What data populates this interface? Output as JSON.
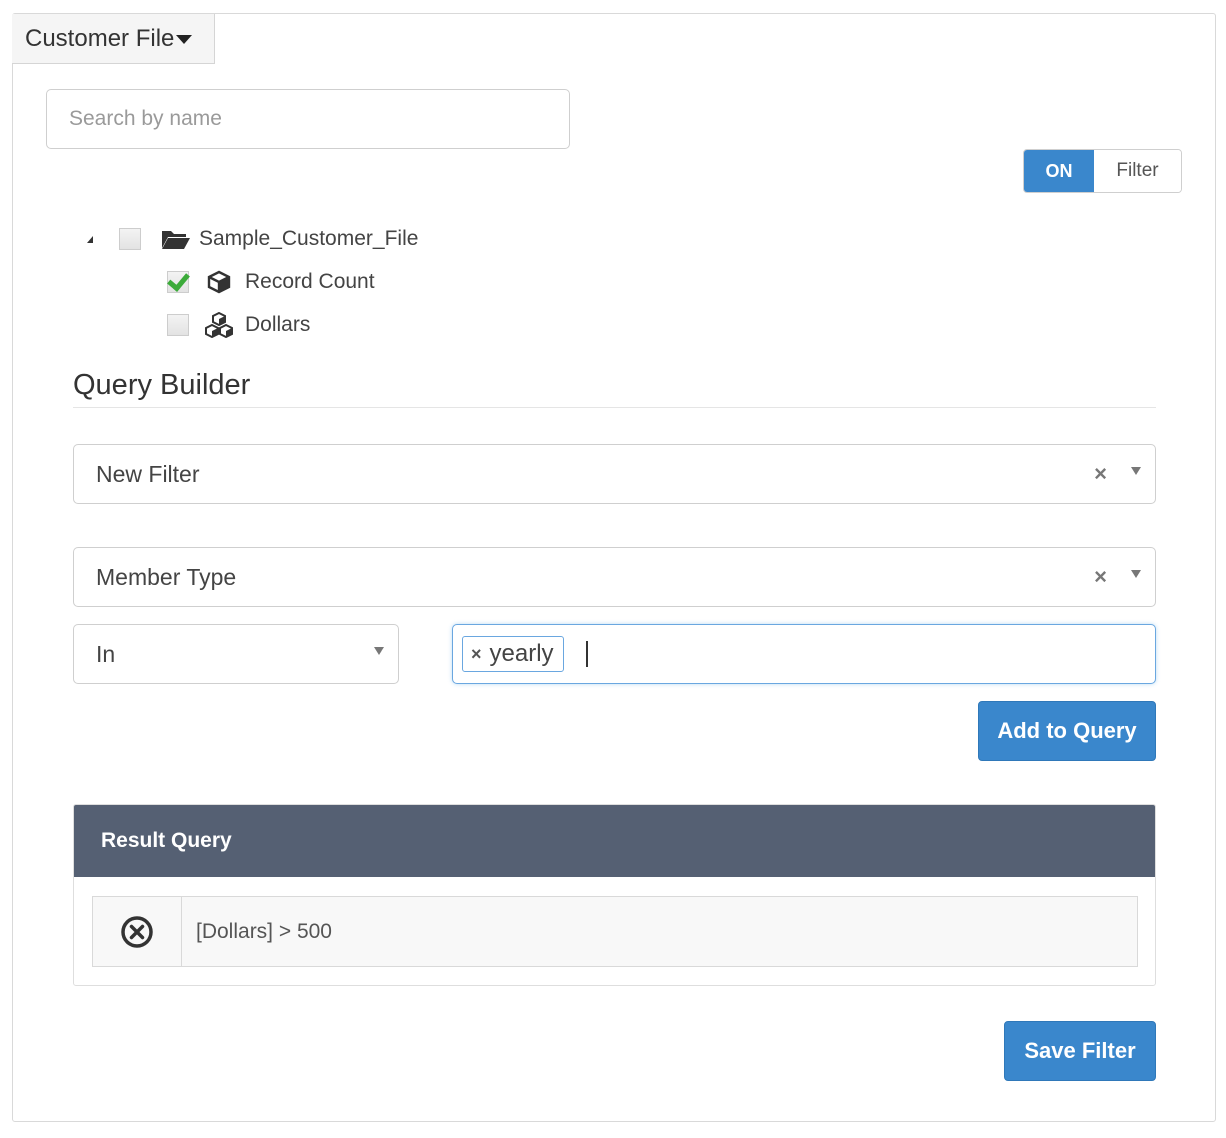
{
  "header": {
    "dropdown_label": "Customer File"
  },
  "search": {
    "placeholder": "Search by name",
    "value": ""
  },
  "filter_toggle": {
    "on_label": "ON",
    "off_label": "Filter",
    "state": "on"
  },
  "tree": {
    "root": {
      "label": "Sample_Customer_File",
      "checked": false,
      "expanded": true
    },
    "children": [
      {
        "label": "Record Count",
        "checked": true,
        "icon": "cube-icon"
      },
      {
        "label": "Dollars",
        "checked": false,
        "icon": "cubes-icon"
      }
    ]
  },
  "query_builder": {
    "title": "Query Builder",
    "filter_select": {
      "value": "New Filter"
    },
    "field_select": {
      "value": "Member Type"
    },
    "operator_select": {
      "value": "In"
    },
    "values": {
      "tags": [
        "yearly"
      ]
    },
    "add_button": "Add to Query"
  },
  "result": {
    "header": "Result Query",
    "rows": [
      {
        "text": "[Dollars] > 500"
      }
    ]
  },
  "save_button": "Save Filter",
  "colors": {
    "primary": "#3a87cc",
    "header_dark": "#556073",
    "check_green": "#3cab3a"
  }
}
